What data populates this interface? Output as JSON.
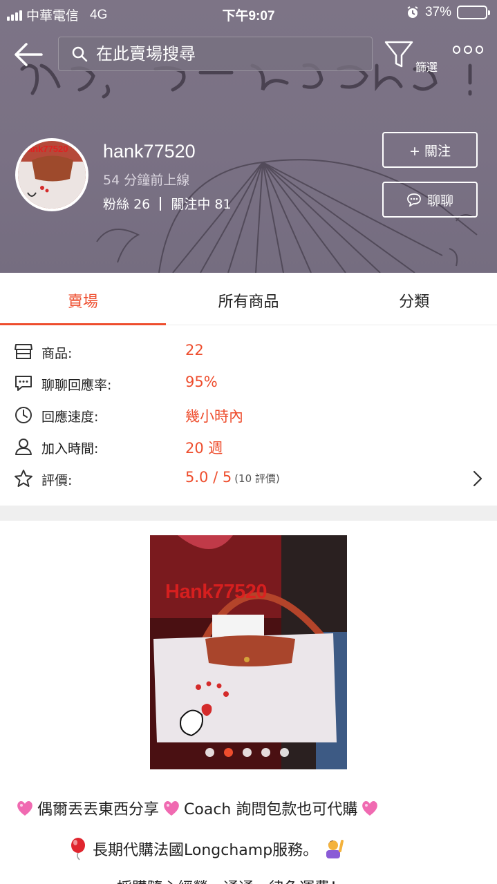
{
  "status_bar": {
    "carrier": "中華電信",
    "network": "4G",
    "time": "下午9:07",
    "battery": "37%",
    "battery_level": 0.37
  },
  "nav": {
    "search_placeholder": "在此賣場搜尋",
    "filter_label": "篩選"
  },
  "profile": {
    "shop_name": "hank77520",
    "avatar_text": "hank77520",
    "online_status": "54 分鐘前上線",
    "followers_label": "粉絲",
    "followers": "26",
    "following_label": "關注中",
    "following": "81",
    "follow_button": "+ 關注",
    "chat_button": "聊聊"
  },
  "tabs": [
    {
      "label": "賣場",
      "active": true
    },
    {
      "label": "所有商品",
      "active": false
    },
    {
      "label": "分類",
      "active": false
    }
  ],
  "info": {
    "products": {
      "label": "商品:",
      "value": "22"
    },
    "response_rate": {
      "label": "聊聊回應率:",
      "value": "95%"
    },
    "response_time": {
      "label": "回應速度:",
      "value": "幾小時內"
    },
    "joined": {
      "label": "加入時間:",
      "value": "20 週"
    },
    "rating": {
      "label": "評價:",
      "value": "5.0 / 5",
      "count": "(10 評價)"
    }
  },
  "photo": {
    "watermark": "Hank77520",
    "slide_count": 5,
    "active_slide": 1
  },
  "description": {
    "line1_a": "偶爾丟丟東西分享",
    "line1_b": "Coach 詢問包款也可代購",
    "line2": "長期代購法國Longchamp服務。",
    "line3": "…… 採購隨心經營，通通一律免運費！"
  },
  "colors": {
    "accent": "#ee4d2d",
    "banner": "#7a7184"
  }
}
